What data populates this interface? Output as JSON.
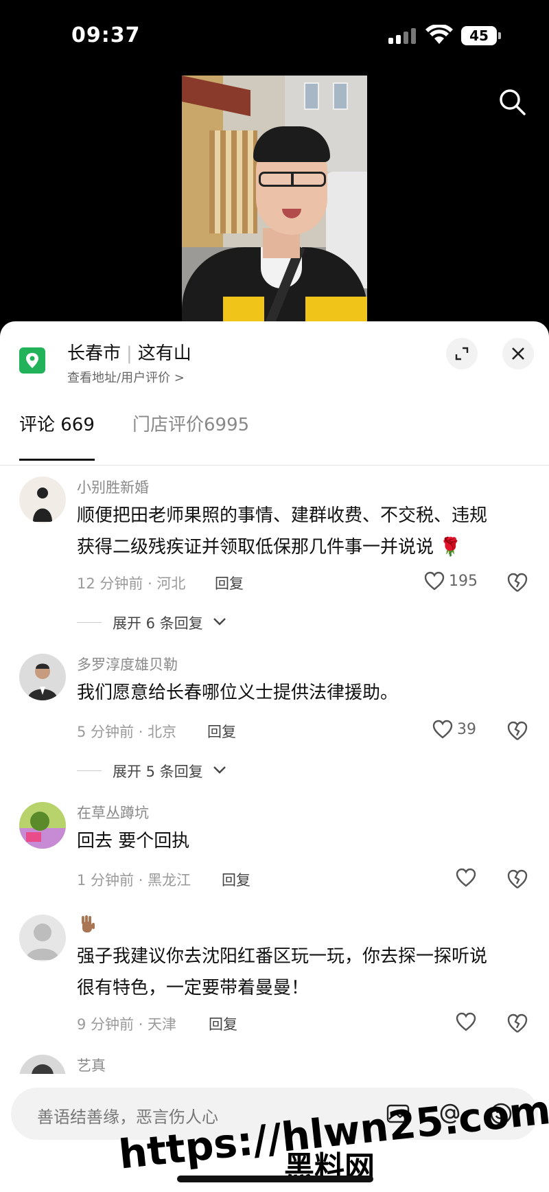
{
  "status_bar": {
    "time": "09:37",
    "battery": "45"
  },
  "location": {
    "city": "长春市",
    "place": "这有山",
    "subtitle": "查看地址/用户评价 >"
  },
  "tabs": [
    {
      "label": "评论 669",
      "active": true
    },
    {
      "label": "门店评价6995",
      "active": false
    }
  ],
  "comments": [
    {
      "user": "小别胜新婚",
      "lines": [
        "顺便把田老师果照的事情、建群收费、不交税、违规",
        "获得二级残疾证并领取低保那几件事一并说说 🌹"
      ],
      "meta": "12 分钟前 · 河北",
      "reply": "回复",
      "likes": "195",
      "expand": "展开 6 条回复"
    },
    {
      "user": "多罗淳度雄贝勒",
      "lines": [
        "我们愿意给长春哪位义士提供法律援助。"
      ],
      "meta": "5 分钟前 · 北京",
      "reply": "回复",
      "likes": "39",
      "expand": "展开 5 条回复"
    },
    {
      "user": "在草丛蹲坑",
      "lines": [
        "回去 要个回执"
      ],
      "meta": "1 分钟前 · 黑龙江",
      "reply": "回复",
      "likes": ""
    },
    {
      "user": "",
      "lines": [
        "强子我建议你去沈阳红番区玩一玩，你去探一探听说",
        "很有特色，一定要带着曼曼！"
      ],
      "meta": "9 分钟前 · 天津",
      "reply": "回复",
      "likes": ""
    },
    {
      "user": "艺真",
      "lines": []
    }
  ],
  "input": {
    "placeholder": "善语结善缘，恶言伤人心"
  },
  "watermark": {
    "url": "https://hlwn25.com",
    "text": "黑料网"
  },
  "icons": [
    "search-icon",
    "location-icon",
    "expand-icon",
    "close-icon",
    "heart-icon",
    "broken-heart-icon",
    "image-icon",
    "at-icon",
    "emoji-icon",
    "chevron-down-icon"
  ],
  "colors": {
    "accent": "#22b35a",
    "text": "#111111",
    "muted": "#8a8a8a"
  }
}
